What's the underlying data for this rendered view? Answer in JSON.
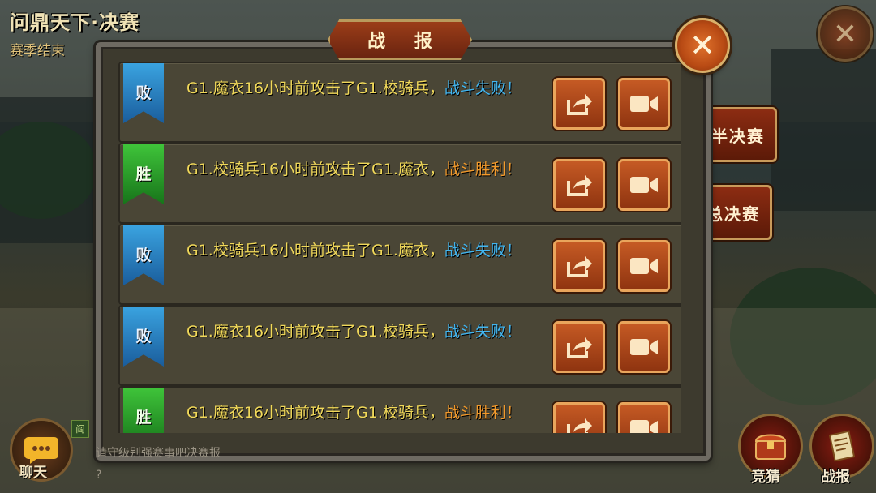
{
  "header": {
    "title": "问鼎天下·决赛",
    "season_status": "赛季结束"
  },
  "dialog": {
    "title": "战 报",
    "close_icon": "close-icon"
  },
  "side_tabs": [
    {
      "label": "半决赛"
    },
    {
      "label": "总决赛"
    }
  ],
  "reports": [
    {
      "badge": "败",
      "result": "lose",
      "text": "G1.魔衣16小时前攻击了G1.校骑兵，",
      "result_text": "战斗失败！"
    },
    {
      "badge": "胜",
      "result": "win",
      "text": "G1.校骑兵16小时前攻击了G1.魔衣，",
      "result_text": "战斗胜利！"
    },
    {
      "badge": "败",
      "result": "lose",
      "text": "G1.校骑兵16小时前攻击了G1.魔衣，",
      "result_text": "战斗失败！"
    },
    {
      "badge": "败",
      "result": "lose",
      "text": "G1.魔衣16小时前攻击了G1.校骑兵，",
      "result_text": "战斗失败！"
    },
    {
      "badge": "胜",
      "result": "win",
      "text": "G1.魔衣16小时前攻击了G1.校骑兵，",
      "result_text": "战斗胜利！"
    }
  ],
  "bottom": {
    "chat_label": "聊天",
    "chat_channel_badge": "阎",
    "chat_message": "请守级别强赛事吧决赛报",
    "chat_message2": "?",
    "guess_label": "竞猜",
    "report_label": "战报"
  },
  "colors": {
    "lose": "#43b6f0",
    "win": "#f29a2c",
    "text": "#f0d85a"
  }
}
